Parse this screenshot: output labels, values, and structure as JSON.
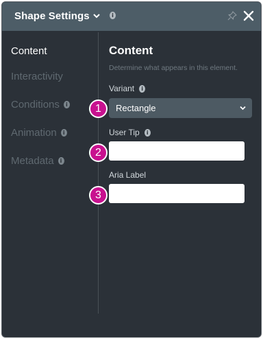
{
  "header": {
    "title": "Shape Settings",
    "info_glyph": "i",
    "icons": {
      "dropdown": "chevron-down-icon",
      "pin": "pin-icon",
      "close": "close-icon"
    }
  },
  "sidebar": {
    "items": [
      {
        "label": "Content",
        "active": true,
        "has_info": false
      },
      {
        "label": "Interactivity",
        "active": false,
        "has_info": false
      },
      {
        "label": "Conditions",
        "active": false,
        "has_info": true
      },
      {
        "label": "Animation",
        "active": false,
        "has_info": true
      },
      {
        "label": "Metadata",
        "active": false,
        "has_info": true
      }
    ]
  },
  "main": {
    "title": "Content",
    "description": "Determine what appears in this element.",
    "variant": {
      "label": "Variant",
      "value": "Rectangle"
    },
    "user_tip": {
      "label": "User Tip",
      "value": ""
    },
    "aria_label": {
      "label": "Aria Label",
      "value": ""
    }
  },
  "badges": [
    "1",
    "2",
    "3"
  ],
  "colors": {
    "panel_bg": "#2b3138",
    "header_bg": "#4d5d67",
    "badge": "#c8118f",
    "select_bg": "#4d5a63"
  }
}
